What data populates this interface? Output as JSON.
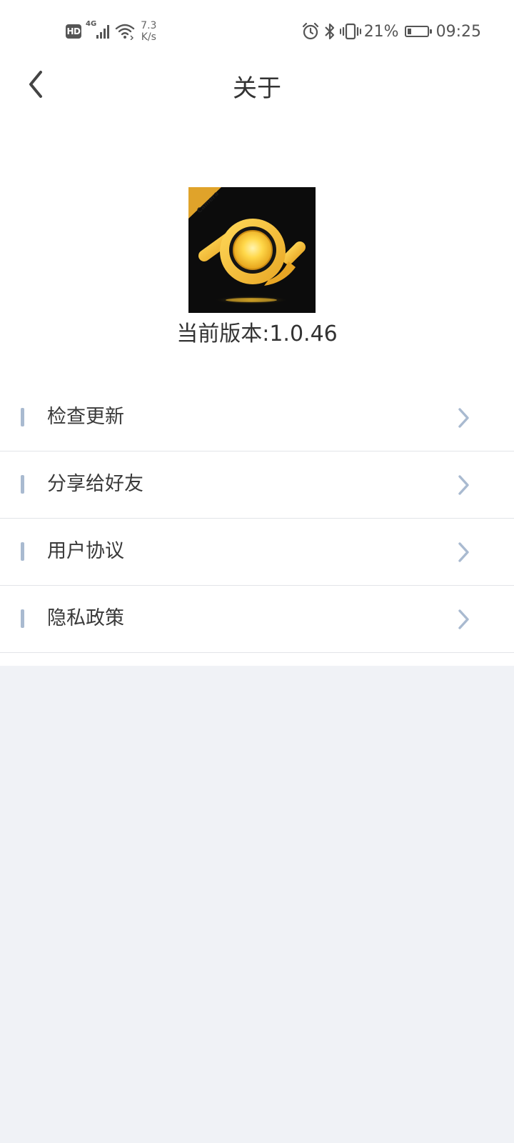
{
  "status_bar": {
    "hd_label": "HD",
    "network_type": "4G",
    "net_speed_value": "7.3",
    "net_speed_unit": "K/s",
    "battery_percent": "21%",
    "battery_level": 0.21,
    "time": "09:25",
    "icons": [
      "signal-icon",
      "wifi-icon",
      "alarm-icon",
      "bluetooth-icon",
      "vibrate-icon",
      "battery-icon"
    ]
  },
  "nav": {
    "title": "关于",
    "back_icon": "chevron-left-icon"
  },
  "app": {
    "logo_badge": "Camera",
    "version_text": "当前版本:1.0.46"
  },
  "menu": {
    "items": [
      {
        "label": "检查更新",
        "icon": "chevron-right-icon"
      },
      {
        "label": "分享给好友",
        "icon": "chevron-right-icon"
      },
      {
        "label": "用户协议",
        "icon": "chevron-right-icon"
      },
      {
        "label": "隐私政策",
        "icon": "chevron-right-icon"
      }
    ]
  },
  "colors": {
    "accent_bar": "#a9bad0",
    "chevron": "#a9bad0",
    "page_background": "#f0f2f6",
    "logo_yellow": "#f6c744"
  }
}
